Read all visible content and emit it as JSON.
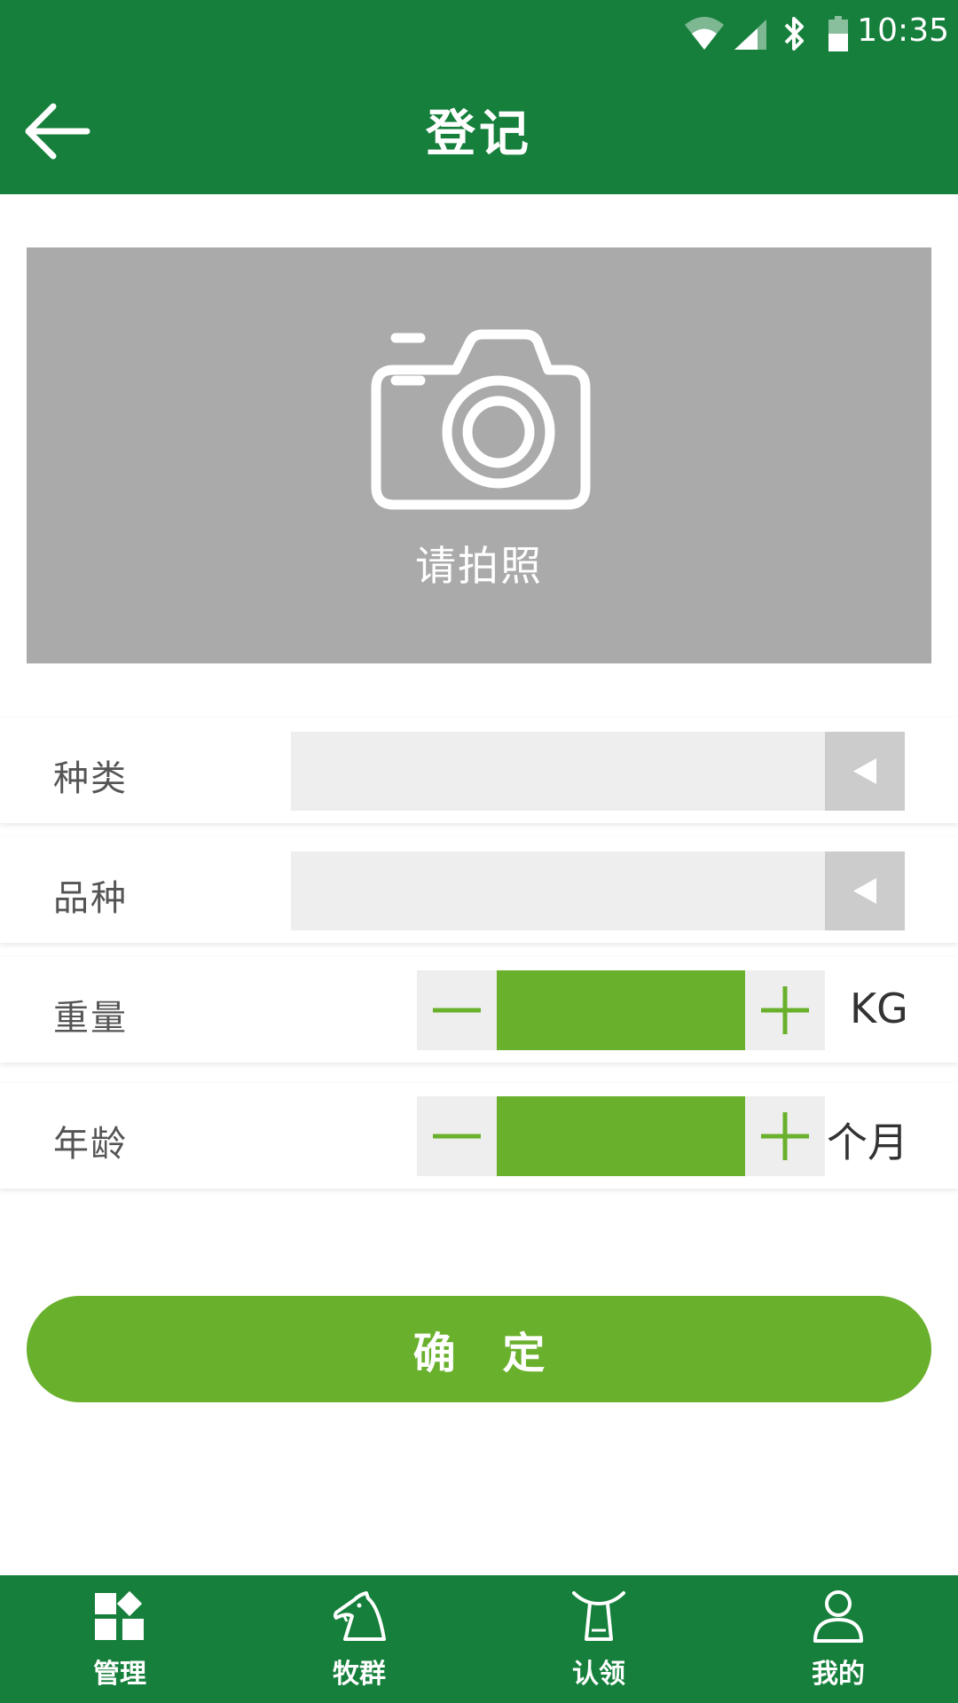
{
  "status_bar": {
    "time": "10:35",
    "icons": [
      "wifi-icon",
      "cell-signal-icon",
      "bluetooth-icon",
      "battery-icon"
    ]
  },
  "header": {
    "title": "登记",
    "back_icon": "arrow-left-icon"
  },
  "photo": {
    "label": "请拍照",
    "icon": "camera-icon"
  },
  "form": {
    "category": {
      "label": "种类",
      "value": ""
    },
    "breed": {
      "label": "品种",
      "value": ""
    },
    "weight": {
      "label": "重量",
      "value": "",
      "unit": "KG"
    },
    "age": {
      "label": "年龄",
      "value": "",
      "unit": "个月"
    }
  },
  "confirm": {
    "label": "确 定"
  },
  "bottom_nav": {
    "items": [
      {
        "label": "管理",
        "icon": "dashboard-icon"
      },
      {
        "label": "牧群",
        "icon": "horse-icon"
      },
      {
        "label": "认领",
        "icon": "bull-icon"
      },
      {
        "label": "我的",
        "icon": "user-icon"
      }
    ]
  },
  "colors": {
    "primary_dark_green": "#157f3b",
    "accent_green": "#69b02c",
    "photo_bg": "#aaaaaa",
    "field_bg": "#eeeeee"
  }
}
